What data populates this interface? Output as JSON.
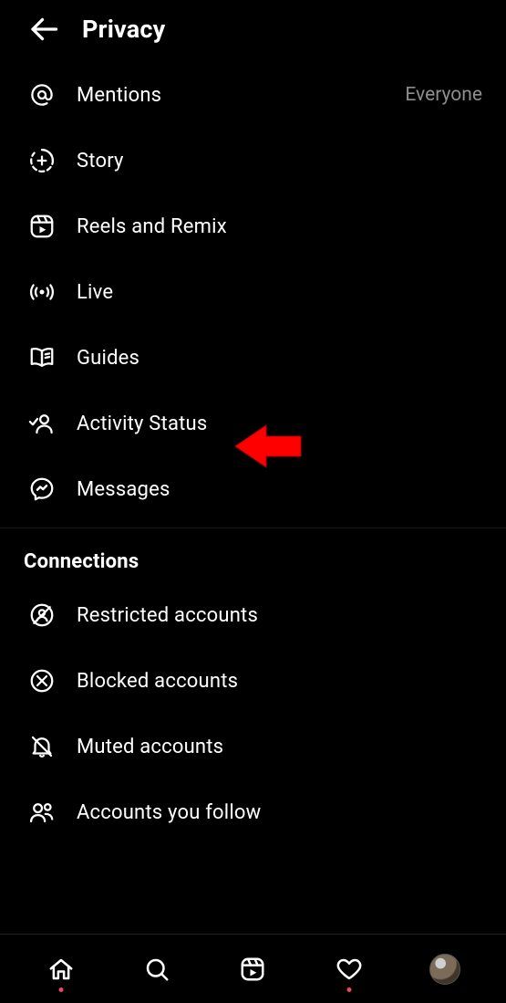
{
  "header": {
    "title": "Privacy"
  },
  "interactions": {
    "items": {
      "mentions": {
        "label": "Mentions",
        "value": "Everyone"
      },
      "story": {
        "label": "Story"
      },
      "reels": {
        "label": "Reels and Remix"
      },
      "live": {
        "label": "Live"
      },
      "guides": {
        "label": "Guides"
      },
      "activity": {
        "label": "Activity Status"
      },
      "messages": {
        "label": "Messages"
      }
    }
  },
  "connections": {
    "title": "Connections",
    "items": {
      "restricted": {
        "label": "Restricted accounts"
      },
      "blocked": {
        "label": "Blocked accounts"
      },
      "muted": {
        "label": "Muted accounts"
      },
      "following": {
        "label": "Accounts you follow"
      }
    }
  },
  "annotation": {
    "target": "activity"
  }
}
